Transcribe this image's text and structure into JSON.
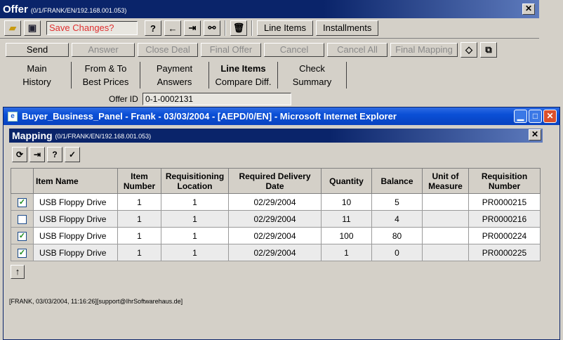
{
  "offer": {
    "title": "Offer",
    "path": "(0/1/FRANK/EN/192.168.001.053)",
    "save_field": "Save Changes?",
    "toolbar_buttons": {
      "line_items": "Line Items",
      "installments": "Installments"
    },
    "actions": {
      "send": "Send",
      "answer": "Answer",
      "close_deal": "Close Deal",
      "final_offer": "Final Offer",
      "cancel": "Cancel",
      "cancel_all": "Cancel All",
      "final_mapping": "Final Mapping"
    },
    "tabs_row1": [
      "Main",
      "From & To",
      "Payment",
      "Line Items",
      "Check"
    ],
    "tabs_row2": [
      "History",
      "Best Prices",
      "Answers",
      "Compare Diff.",
      "Summary"
    ],
    "offer_id_label": "Offer ID",
    "offer_id_value": "0-1-0002131"
  },
  "ie": {
    "title": "Buyer_Business_Panel - Frank - 03/03/2004 - [AEPD/0/EN] - Microsoft Internet Explorer"
  },
  "mapping": {
    "title": "Mapping",
    "path": "(0/1/FRANK/EN/192.168.001.053)",
    "columns": [
      "Item Name",
      "Item Number",
      "Requisitioning Location",
      "Required Delivery Date",
      "Quantity",
      "Balance",
      "Unit of Measure",
      "Requisition Number"
    ],
    "rows": [
      {
        "checked": true,
        "item_name": "USB Floppy Drive",
        "item_number": "1",
        "location": "1",
        "date": "02/29/2004",
        "quantity": "10",
        "balance": "5",
        "uom": "",
        "req_number": "PR0000215"
      },
      {
        "checked": false,
        "item_name": "USB Floppy Drive",
        "item_number": "1",
        "location": "1",
        "date": "02/29/2004",
        "quantity": "11",
        "balance": "4",
        "uom": "",
        "req_number": "PR0000216"
      },
      {
        "checked": true,
        "item_name": "USB Floppy Drive",
        "item_number": "1",
        "location": "1",
        "date": "02/29/2004",
        "quantity": "100",
        "balance": "80",
        "uom": "",
        "req_number": "PR0000224"
      },
      {
        "checked": true,
        "item_name": "USB Floppy Drive",
        "item_number": "1",
        "location": "1",
        "date": "02/29/2004",
        "quantity": "1",
        "balance": "0",
        "uom": "",
        "req_number": "PR0000225"
      }
    ],
    "footer": "[FRANK, 03/03/2004, 11:16:26][support@IhrSoftwarehaus.de]"
  }
}
